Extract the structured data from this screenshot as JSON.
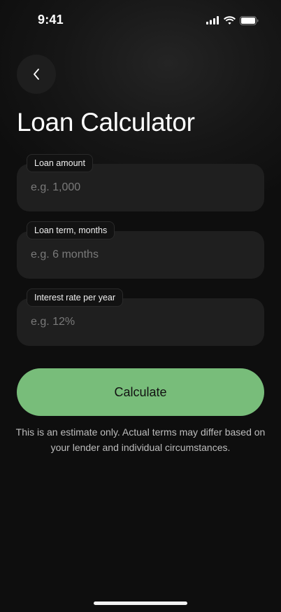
{
  "status_bar": {
    "time": "9:41",
    "icons": [
      "cellular-signal-icon",
      "wifi-icon",
      "battery-icon"
    ]
  },
  "header": {
    "back_icon": "chevron-left-icon",
    "title": "Loan Calculator"
  },
  "form": {
    "amount": {
      "label": "Loan amount",
      "placeholder": "e.g. 1,000",
      "value": ""
    },
    "term": {
      "label": "Loan term, months",
      "placeholder": "e.g. 6 months",
      "value": ""
    },
    "rate": {
      "label": "Interest rate per year",
      "placeholder": "e.g. 12%",
      "value": ""
    }
  },
  "actions": {
    "calculate_label": "Calculate"
  },
  "disclaimer": "This is an estimate only. Actual terms may differ based on your lender and individual circumstances.",
  "colors": {
    "background": "#0e0e0e",
    "field_background": "#1f1f1f",
    "accent": "#78bd7a",
    "text_primary": "#ffffff",
    "text_secondary": "#bdbdbd",
    "placeholder": "#7a7a7a"
  }
}
